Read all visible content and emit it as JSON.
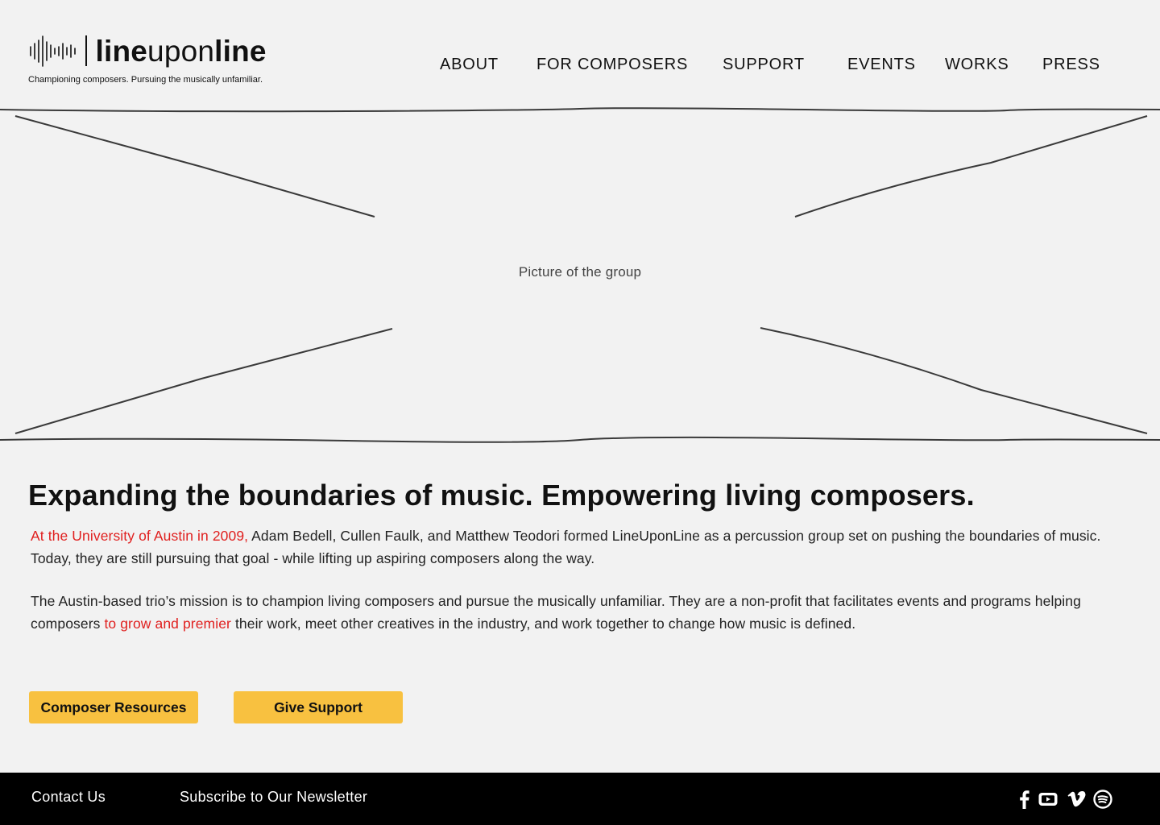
{
  "brand": {
    "name_part1": "line",
    "name_part2": "upon",
    "name_part3": "line",
    "tagline": "Championing composers. Pursuing the musically unfamiliar."
  },
  "nav": {
    "items": [
      {
        "label": "ABOUT"
      },
      {
        "label": "FOR COMPOSERS"
      },
      {
        "label": "SUPPORT"
      },
      {
        "label": "EVENTS"
      },
      {
        "label": "WORKS"
      },
      {
        "label": "PRESS"
      }
    ]
  },
  "hero": {
    "image_label": "Picture of the group"
  },
  "main": {
    "headline": "Expanding the boundaries of music. Empowering living composers.",
    "paragraph1": {
      "link_text": "At the University of Austin in  2009,",
      "text": " Adam Bedell, Cullen Faulk, and Matthew Teodori formed LineUponLine as a percussion group set on pushing the boundaries of music. Today, they are still pursuing that goal - while lifting up aspiring composers along the way."
    },
    "paragraph2": {
      "text_before": "The Austin-based trio’s mission is to champion living composers and pursue the musically unfamiliar. They are a non-profit that facilitates events and programs helping composers ",
      "link_text": "to grow and premier",
      "text_after": " their work, meet other creatives in the industry, and work together to change how music is defined."
    },
    "buttons": {
      "composer_resources": "Composer Resources",
      "give_support": "Give Support"
    }
  },
  "footer": {
    "contact": "Contact Us",
    "newsletter": "Subscribe to Our Newsletter",
    "social_icons": [
      "facebook-icon",
      "youtube-icon",
      "vimeo-icon",
      "spotify-icon"
    ]
  },
  "colors": {
    "background": "#f2f2f2",
    "accent_button": "#f8c140",
    "link_red": "#e0201f",
    "footer_bg": "#000000"
  }
}
